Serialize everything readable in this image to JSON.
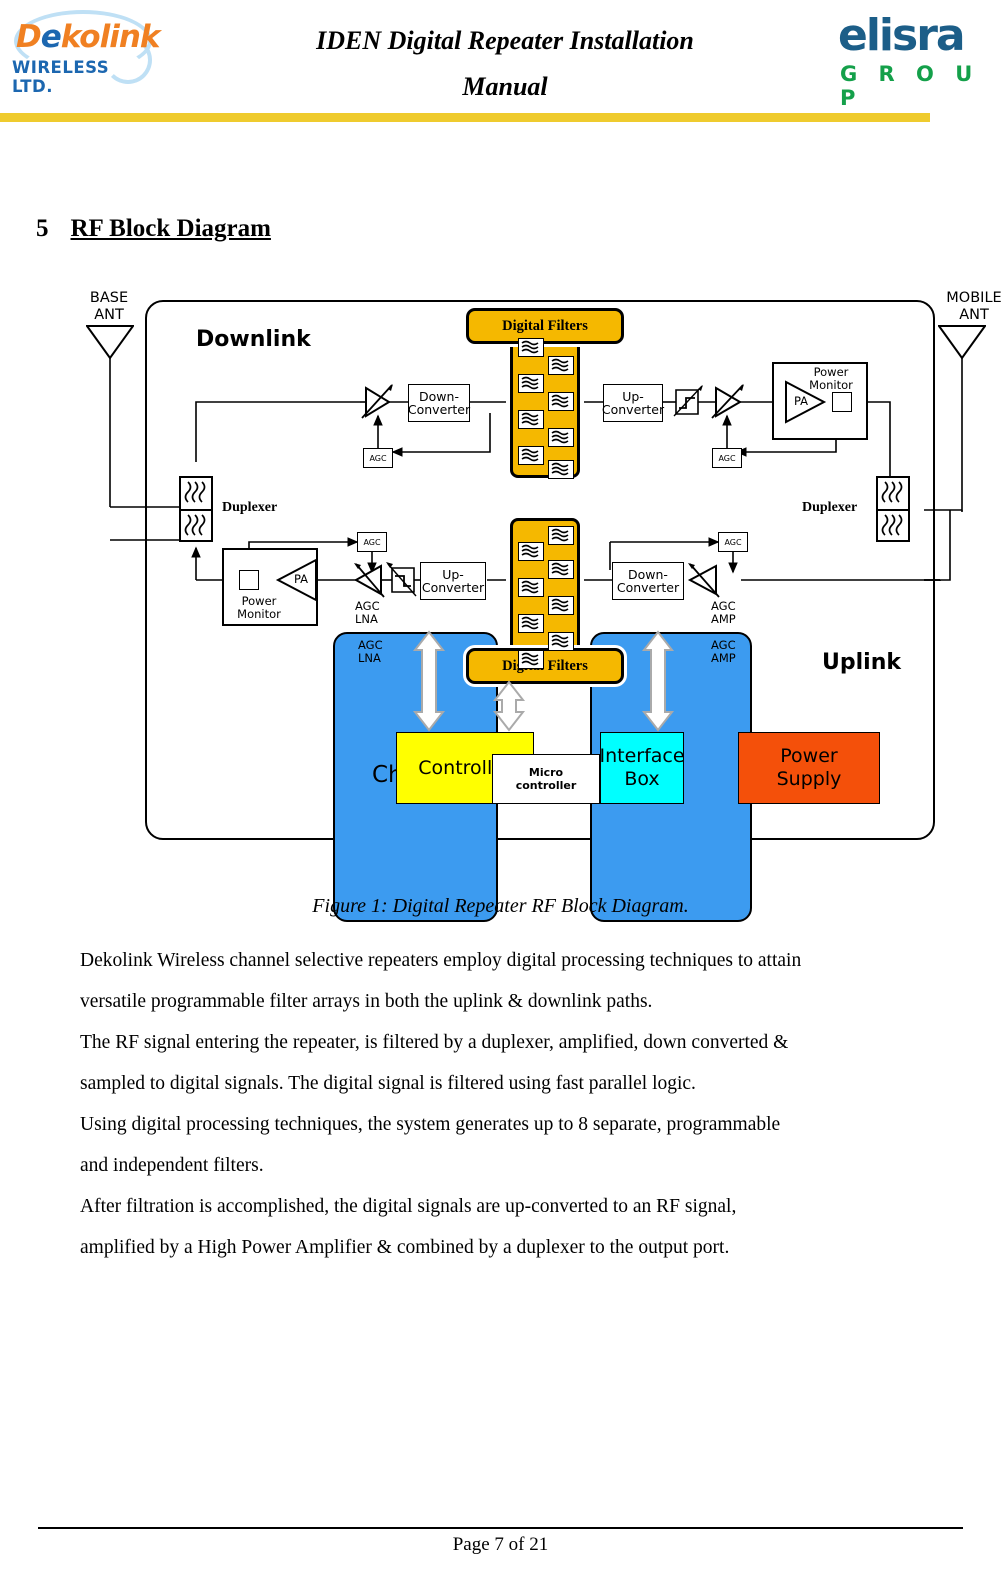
{
  "header": {
    "title_line1": "IDEN Digital Repeater Installation",
    "title_line2": "Manual",
    "dekolink_logo": {
      "d": "D",
      "e": "e",
      "rest": "kolink",
      "sub": "WIRELESS LTD."
    },
    "elisra_logo": {
      "name": "elisra",
      "group": "G R O U P"
    },
    "rule_color": "#EFCB2E"
  },
  "section": {
    "number": "5",
    "title": "RF Block Diagram"
  },
  "diagram": {
    "base_ant_line1": "BASE",
    "base_ant_line2": "ANT",
    "mobile_ant_line1": "MOBILE",
    "mobile_ant_line2": "ANT",
    "downlink_label": "Downlink",
    "uplink_label": "Uplink",
    "channeler_label": "Channeler",
    "micro_controller": "Micro\ncontroller",
    "micro_controller_line1": "Micro",
    "micro_controller_line2": "controller",
    "duplexer_left": "Duplexer",
    "duplexer_right": "Duplexer",
    "digital_filters_top": "Digital Filters",
    "digital_filters_bottom": "Digital Filters",
    "filter_count_per_block": 8,
    "downlink": {
      "agc_lna_tag": "AGC\nLNA",
      "agc_lna_line1": "AGC",
      "agc_lna_line2": "LNA",
      "down_converter": "Down-\nConverter",
      "down_converter_line1": "Down-",
      "down_converter_line2": "Converter",
      "up_converter": "Up-\nConverter",
      "up_converter_line1": "Up-",
      "up_converter_line2": "Converter",
      "agc_amp_line1": "AGC",
      "agc_amp_line2": "AMP",
      "agc_box": "AGC",
      "pa": "PA",
      "power_monitor_line1": "Power",
      "power_monitor_line2": "Monitor"
    },
    "uplink": {
      "agc_lna_line1": "AGC",
      "agc_lna_line2": "LNA",
      "up_converter_line1": "Up-",
      "up_converter_line2": "Converter",
      "down_converter_line1": "Down-",
      "down_converter_line2": "Converter",
      "agc_amp_line1": "AGC",
      "agc_amp_line2": "AMP",
      "agc_box": "AGC",
      "pa": "PA",
      "power_monitor_line1": "Power",
      "power_monitor_line2": "Monitor"
    },
    "bottom_boxes": [
      {
        "label_line1": "Controller",
        "label_line2": "",
        "color": "#FFFF00"
      },
      {
        "label_line1": "Interface",
        "label_line2": "Box",
        "color": "#00FFFF"
      },
      {
        "label_line1": "Power",
        "label_line2": "Supply",
        "color": "#F4500A"
      }
    ],
    "colors": {
      "channeler_blue": "#3C9BF0",
      "digital_filters_gold": "#F5B800",
      "controller_yellow": "#FFFF00",
      "interface_cyan": "#00FFFF",
      "power_supply_orange": "#F4500A"
    }
  },
  "caption": "Figure 1: Digital Repeater RF Block Diagram.",
  "body_lines": [
    "Dekolink Wireless channel selective repeaters employ digital processing techniques to attain",
    "versatile programmable filter arrays in both the uplink & downlink paths.",
    " The RF signal entering the repeater, is filtered by a duplexer, amplified, down converted  &",
    "sampled to digital signals. The digital signal is filtered using fast parallel logic.",
    "Using digital processing techniques, the system generates up to 8 separate, programmable",
    "and independent filters.",
    "        After filtration is accomplished, the digital signals are up-converted to an RF signal,",
    " amplified by a High Power Amplifier  & combined by a duplexer to the output port."
  ],
  "footer": {
    "page_text": "Page 7 of 21"
  }
}
